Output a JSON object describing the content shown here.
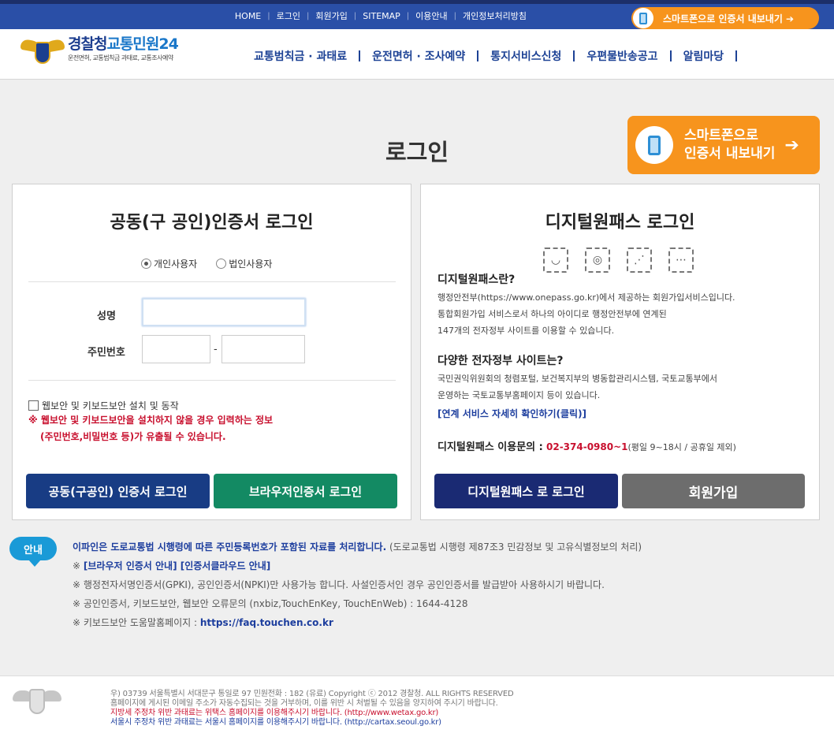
{
  "topbar": {
    "links": [
      "HOME",
      "로그인",
      "회원가입",
      "SITEMAP",
      "이용안내",
      "개인정보처리방침"
    ],
    "cert_button": "스마트폰으로 인증서 내보내기 ➔"
  },
  "header": {
    "logo_main_1": "경찰청",
    "logo_main_2": "교통민원24",
    "logo_sub": "운전면허, 교통범칙금 과태료, 교통조사예약",
    "menu": [
      "교통범칙금 · 과태료",
      "운전면허 · 조사예약",
      "통지서비스신청",
      "우편물반송공고",
      "알림마당"
    ]
  },
  "page": {
    "title": "로그인",
    "cert_banner_line1": "스마트폰으로",
    "cert_banner_line2": "인증서 내보내기",
    "cert_banner_arrow": "➔"
  },
  "cert_login": {
    "title": "공동(구 공인)인증서 로그인",
    "radio_personal": "개인사용자",
    "radio_corporate": "법인사용자",
    "name_label": "성명",
    "rrn_label": "주민번호",
    "rrn_dash": "-",
    "checkbox_label": "웹보안 및 키보드보안 설치 및 동작",
    "warning_line1": "※ 웹보안 및 키보드보안을 설치하지 않을 경우 입력하는 정보",
    "warning_line2": "(주민번호,비밀번호 등)가 유출될 수 있습니다.",
    "btn_cert": "공동(구공인) 인증서 로그인",
    "btn_browser": "브라우저인증서 로그인"
  },
  "onepass": {
    "title": "디지털원패스 로그인",
    "icons": [
      "face-icon",
      "fingerprint-icon",
      "pattern-icon",
      "pin-icon"
    ],
    "what_title": "디지털원패스란?",
    "what_desc": [
      "행정안전부(https://www.onepass.go.kr)에서 제공하는 회원가입서비스입니다.",
      "통합회원가입 서비스로서 하나의 아이디로 행정안전부에 연계된",
      "147개의 전자정부 사이트를 이용할 수 있습니다."
    ],
    "sites_title": "다양한 전자정부 사이트는?",
    "sites_desc": [
      "국민권익위원회의 청렴포털, 보건복지부의 병동합관리시스템, 국토교통부에서",
      "운영하는 국토교통부홈페이지 등이 있습니다."
    ],
    "link": "[연계 서비스 자세히 확인하기(클릭)]",
    "contact_label": "디지털원패스 이용문의 :",
    "contact_phone": "02-374-0980~1",
    "contact_hours": "(평일 9~18시 / 공휴일 제외)",
    "btn_login": "디지털원패스 로 로그인",
    "btn_join": "회원가입"
  },
  "notice": {
    "badge": "안내",
    "line1_bold": "이파인은 도로교통법 시행령에 따른 주민등록번호가 포함된 자료를 처리합니다.",
    "line1_rest": " (도로교통법 시행령 제87조3 민감정보 및 고유식별정보의 처리)",
    "line2_prefix": "※ ",
    "line2_link": "[브라우저 인증서 안내] [인증서클라우드 안내]",
    "line3": "※ 행정전자서명인증서(GPKI), 공인인증서(NPKI)만 사용가능 합니다. 사설인증서인 경우 공인인증서를 발급받아 사용하시기 바랍니다.",
    "line4": "※ 공인인증서, 키보드보안, 웹보안 오류문의 (nxbiz,TouchEnKey, TouchEnWeb) : 1644-4128",
    "line5_prefix": "※ 키보드보안 도움말홈페이지 : ",
    "line5_link": "https://faq.touchen.co.kr"
  },
  "footer": {
    "line1": "우) 03739 서울특별시 서대문구 통일로 97  민원전화 : 182 (유료)       Copyright ⓒ 2012 경찰청. ALL RIGHTS RESERVED",
    "line2": "홈페이지에 게시된 이메일 주소가 자동수집되는 것을 거부하며, 이를 위반 시 처벌될 수 있음을 양지하여 주시기 바랍니다.",
    "line3": "지방세 주정차 위반 과태료는 위택스 홈페이지를 이용해주시기 바랍니다. (http://www.wetax.go.kr)",
    "line4": "서울시 주정차 위반 과태료는 서울시 홈페이지를 이용해주시기 바랍니다. (http://cartax.seoul.go.kr)"
  },
  "colors": {
    "topbar": "#2a4fa7",
    "accent_orange": "#f7941d",
    "navy": "#183c84",
    "green": "#138a63",
    "warning_red": "#c8102e"
  }
}
